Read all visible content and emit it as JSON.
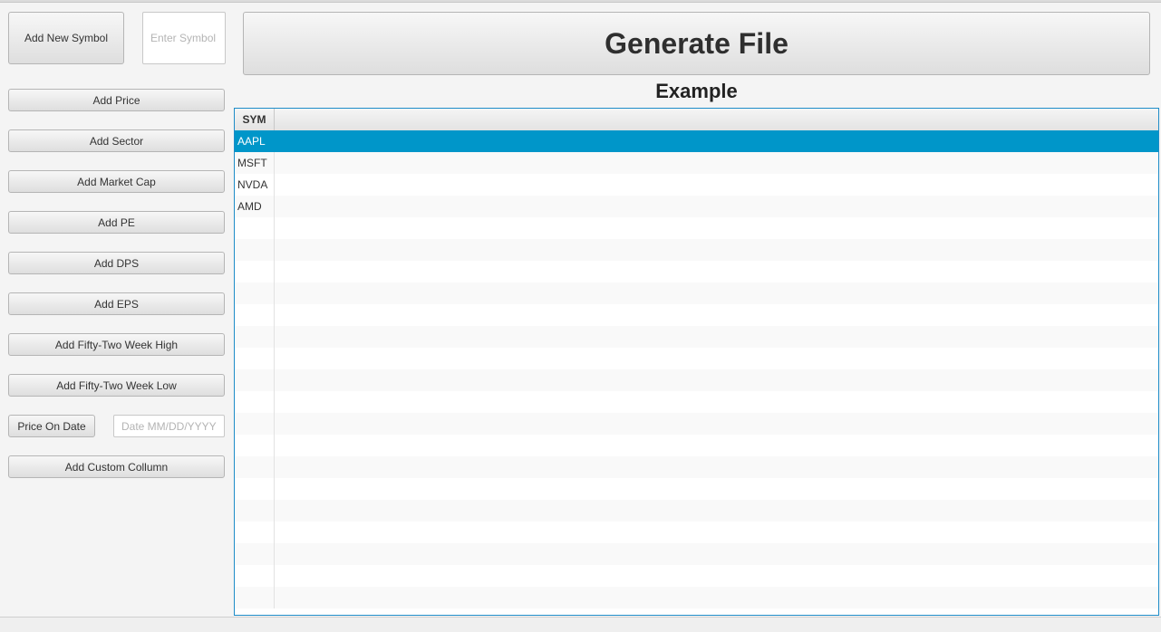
{
  "toolbar": {
    "add_new_symbol": "Add New Symbol",
    "symbol_placeholder": "Enter Symbol",
    "generate_file": "Generate File"
  },
  "sidebar": {
    "add_price": "Add Price",
    "add_sector": "Add Sector",
    "add_market_cap": "Add Market Cap",
    "add_pe": "Add PE",
    "add_dps": "Add DPS",
    "add_eps": "Add EPS",
    "add_52_high": "Add Fifty-Two Week High",
    "add_52_low": "Add Fifty-Two Week Low",
    "price_on_date": "Price On Date",
    "date_placeholder": "Date MM/DD/YYYY",
    "add_custom_column": "Add Custom Collumn"
  },
  "table": {
    "title": "Example",
    "columns": [
      "SYM"
    ],
    "rows": [
      "AAPL",
      "MSFT",
      "NVDA",
      "AMD"
    ],
    "selected_row": 0
  },
  "colors": {
    "selection": "#0096c9",
    "focus_border": "#1e8cc8"
  }
}
